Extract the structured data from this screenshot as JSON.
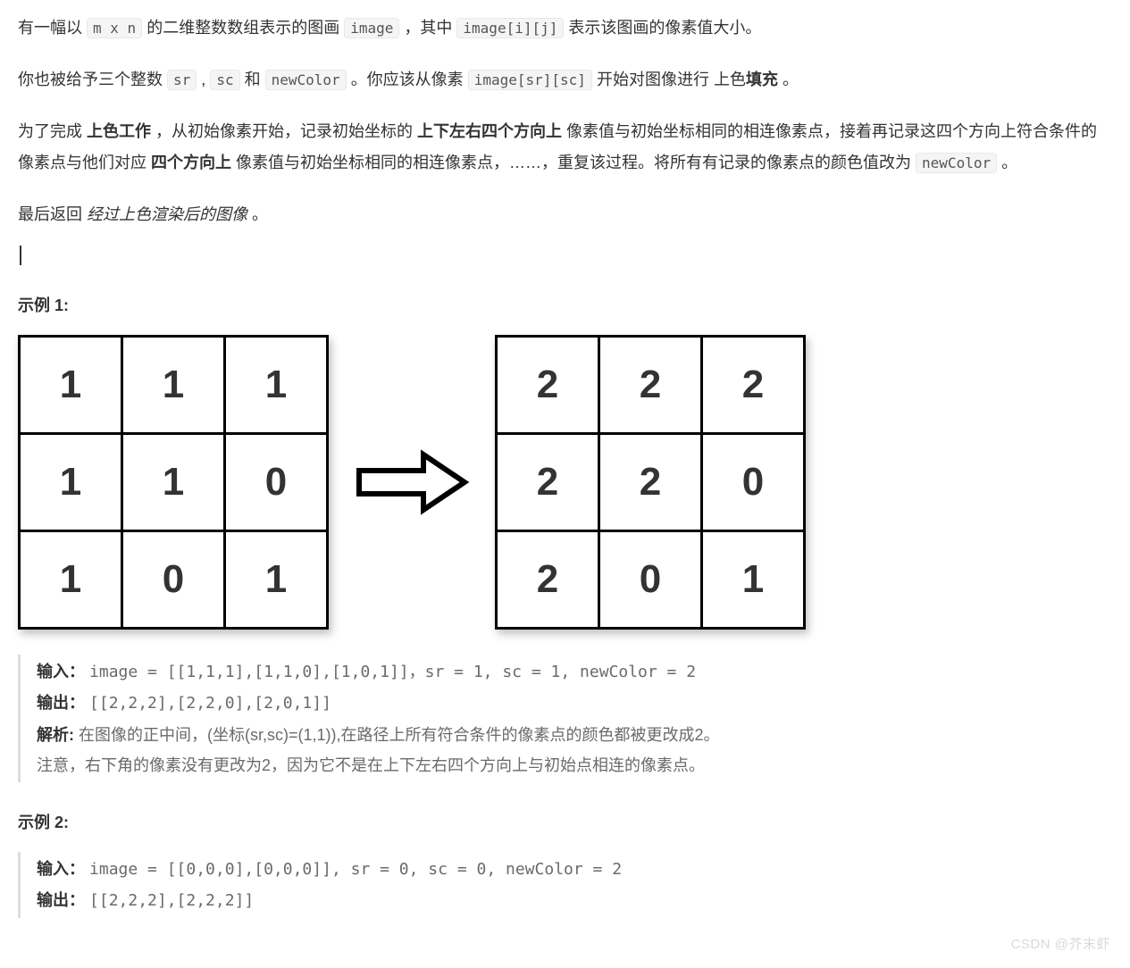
{
  "desc": {
    "p1": {
      "a": "有一幅以 ",
      "c1": "m x n",
      "b": " 的二维整数数组表示的图画 ",
      "c2": "image",
      "c": " ，其中 ",
      "c3": "image[i][j]",
      "d": " 表示该图画的像素值大小。"
    },
    "p2": {
      "a": "你也被给予三个整数 ",
      "c1": "sr",
      "b": " , ",
      "c2": "sc",
      "c": " 和 ",
      "c3": "newColor",
      "d": " 。你应该从像素 ",
      "c4": "image[sr][sc]",
      "e": " 开始对图像进行 上色",
      "bold": "填充",
      "f": " 。"
    },
    "p3": {
      "a": "为了完成 ",
      "b1": "上色工作",
      "b": " ，从初始像素开始，记录初始坐标的 ",
      "b2": "上下左右四个方向上",
      "c": " 像素值与初始坐标相同的相连像素点，接着再记录这四个方向上符合条件的像素点与他们对应 ",
      "b3": "四个方向上",
      "d": " 像素值与初始坐标相同的相连像素点，……，重复该过程。将所有有记录的像素点的颜色值改为 ",
      "c1": "newColor",
      "e": " 。"
    },
    "p4": {
      "a": "最后返回 ",
      "i": "经过上色渲染后的图像",
      "b": " 。"
    }
  },
  "grids": {
    "left": [
      [
        {
          "v": "1",
          "c": "blue"
        },
        {
          "v": "1",
          "c": "blue"
        },
        {
          "v": "1",
          "c": "blue"
        }
      ],
      [
        {
          "v": "1",
          "c": "blue"
        },
        {
          "v": "1",
          "c": "pink"
        },
        {
          "v": "0",
          "c": ""
        }
      ],
      [
        {
          "v": "1",
          "c": "blue"
        },
        {
          "v": "0",
          "c": ""
        },
        {
          "v": "1",
          "c": ""
        }
      ]
    ],
    "right": [
      [
        {
          "v": "2",
          "c": ""
        },
        {
          "v": "2",
          "c": ""
        },
        {
          "v": "2",
          "c": ""
        }
      ],
      [
        {
          "v": "2",
          "c": ""
        },
        {
          "v": "2",
          "c": ""
        },
        {
          "v": "0",
          "c": ""
        }
      ],
      [
        {
          "v": "2",
          "c": ""
        },
        {
          "v": "0",
          "c": ""
        },
        {
          "v": "1",
          "c": ""
        }
      ]
    ]
  },
  "sections": {
    "ex1_title": "示例 1:",
    "ex2_title": "示例 2:"
  },
  "ex1": {
    "input_label": "输入：",
    "input_value": "image = [[1,1,1],[1,1,0],[1,0,1]]，sr = 1, sc = 1, newColor = 2",
    "output_label": "输出：",
    "output_value": "[[2,2,2],[2,2,0],[2,0,1]]",
    "explain_label": "解析: ",
    "explain_value": "在图像的正中间，(坐标(sr,sc)=(1,1)),在路径上所有符合条件的像素点的颜色都被更改成2。",
    "note": "注意，右下角的像素没有更改为2，因为它不是在上下左右四个方向上与初始点相连的像素点。"
  },
  "ex2": {
    "input_label": "输入：",
    "input_value": "image = [[0,0,0],[0,0,0]], sr = 0, sc = 0, newColor = 2",
    "output_label": "输出：",
    "output_value": "[[2,2,2],[2,2,2]]"
  },
  "watermark": "CSDN @芥末虾"
}
